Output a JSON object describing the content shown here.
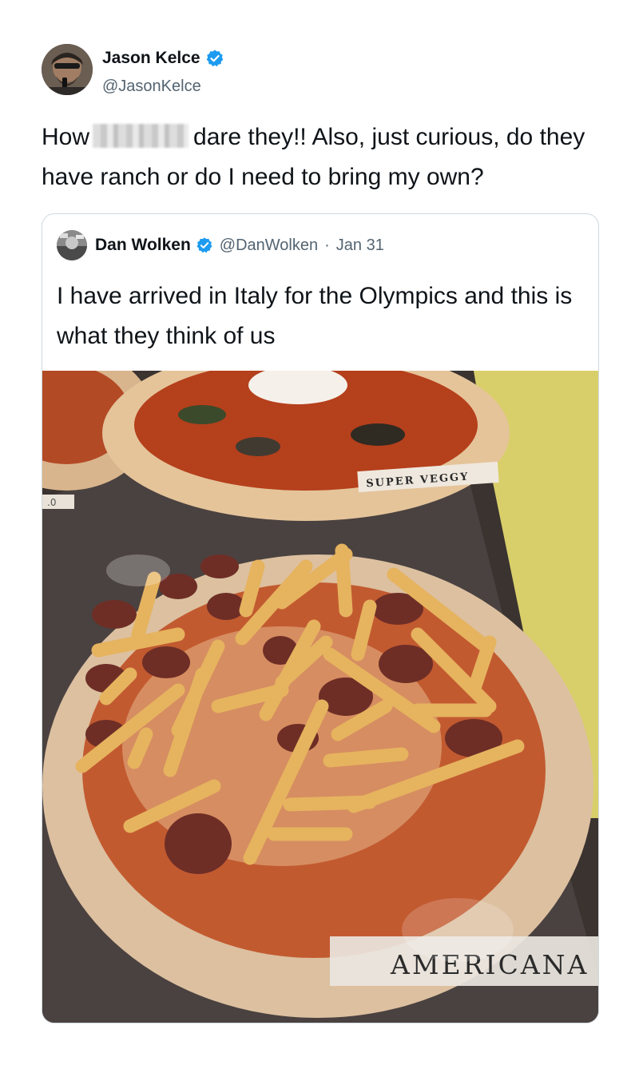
{
  "author": {
    "name": "Jason Kelce",
    "handle": "@JasonKelce",
    "verified_icon": "verified-badge-icon"
  },
  "tweet": {
    "text_before": "How",
    "censored_word_icon": "blurred-censor",
    "text_after": "dare they!! Also, just curious, do they have ranch or do I need to bring my own?"
  },
  "quoted_tweet": {
    "name": "Dan Wolken",
    "handle": "@DanWolken",
    "separator": "·",
    "date": "Jan 31",
    "text": "I have arrived in Italy for the Olympics and this is what they think of us",
    "photo": {
      "label_top": "SUPER VEGGY",
      "label_main": "AMERICANA",
      "corner_label": ".0"
    }
  },
  "colors": {
    "verified_blue": "#1d9bf0",
    "secondary_text": "#536471",
    "border": "#cfd9de"
  }
}
